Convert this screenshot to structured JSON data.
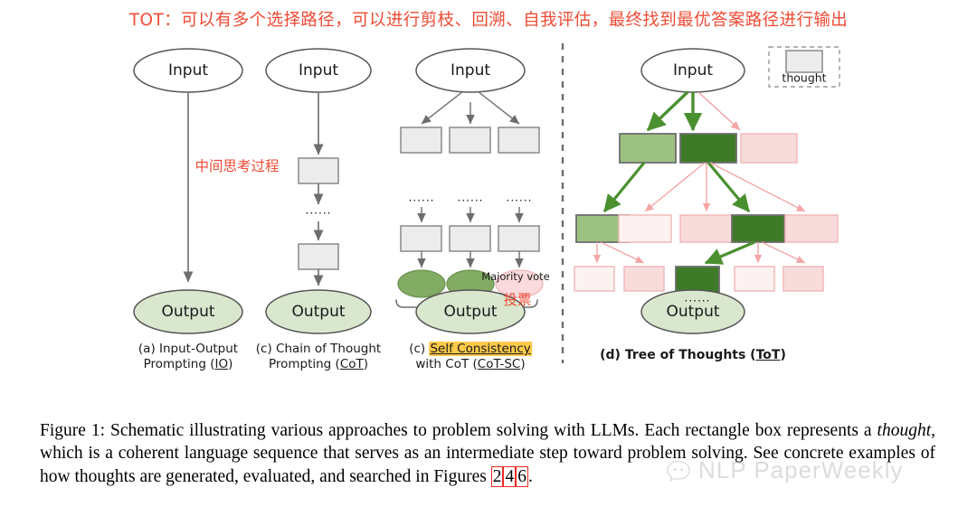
{
  "headline": "TOT：可以有多个选择路径，可以进行剪枝、回溯、自我评估，最终找到最优答案路径进行输出",
  "panels": {
    "io": {
      "input_label": "Input",
      "output_label": "Output",
      "caption_line1": "(a) Input-Output",
      "caption_line2_pre": "Prompting (",
      "caption_line2_abbr": "IO",
      "caption_line2_post": ")",
      "annotation": "中间思考过程"
    },
    "cot": {
      "input_label": "Input",
      "output_label": "Output",
      "ellipsis": "······",
      "caption_line1": "(c) Chain of Thought",
      "caption_line2_pre": "Prompting (",
      "caption_line2_abbr": "CoT",
      "caption_line2_post": ")"
    },
    "cotsc": {
      "input_label": "Input",
      "output_label": "Output",
      "ellipsis": "······",
      "majority_vote": "Majority vote",
      "annotation": "投票",
      "caption_line1_pre": "(c) ",
      "caption_line1_hl": "Self Consistency",
      "caption_line2_pre": "with CoT (",
      "caption_line2_abbr": "CoT-SC",
      "caption_line2_post": ")"
    },
    "tot": {
      "input_label": "Input",
      "output_label": "Output",
      "ellipsis": "······",
      "legend_label": "thought",
      "caption_pre": "(d) Tree of Thoughts (",
      "caption_abbr": "ToT",
      "caption_post": ")"
    }
  },
  "caption": {
    "seg1": "Figure 1: Schematic illustrating various approaches to problem solving with LLMs. Each rectangle box represents a ",
    "italic": "thought",
    "seg2": ", which is a coherent language sequence that serves as an intermediate step toward problem solving. See concrete examples of how thoughts are generated, evaluated, and searched in Figures ",
    "ref1": "2",
    "ref2": "4",
    "ref3": "6",
    "seg3": "."
  },
  "watermark": {
    "text": "NLP PaperWeekly"
  },
  "colors": {
    "red_annotation": "#ef4b35",
    "thought_box_fill": "#ececec",
    "thought_box_stroke": "#8a8a8a",
    "output_green": "#d9e7cf",
    "vote_green": "#82ab63",
    "vote_pink": "#fadadd",
    "tot_green_dark": "#3f7a28",
    "tot_green_light": "#9dc183",
    "tot_pink": "#f8dcdc",
    "tot_pink_pale": "#fdf2f2",
    "arrow_green": "#4a9030",
    "arrow_pink": "#f4a6a6",
    "highlight_yellow": "#fcc94a",
    "ref_box_red": "#ee2a22"
  }
}
